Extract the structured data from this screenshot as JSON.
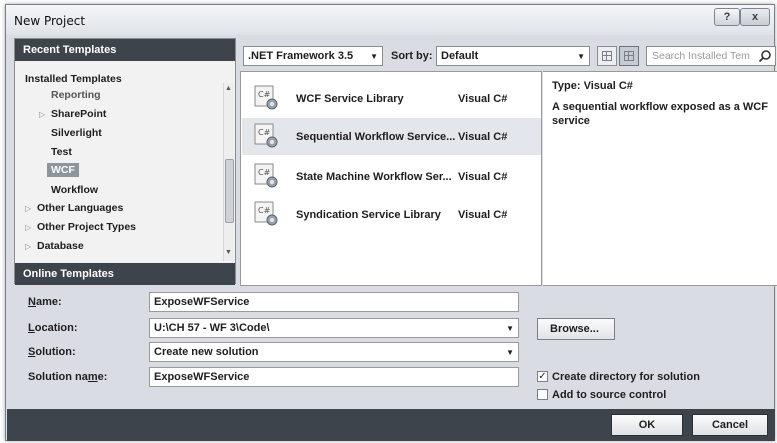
{
  "window": {
    "title": "New Project",
    "help_glyph": "?",
    "close_glyph": "x"
  },
  "left_panel": {
    "recent_header": "Recent Templates",
    "installed_label": "Installed Templates",
    "tree": [
      {
        "label": "Reporting"
      },
      {
        "label": "SharePoint"
      },
      {
        "label": "Silverlight"
      },
      {
        "label": "Test"
      },
      {
        "label": "WCF"
      },
      {
        "label": "Workflow"
      },
      {
        "label": "Other Languages"
      },
      {
        "label": "Other Project Types"
      },
      {
        "label": "Database"
      }
    ],
    "online_header": "Online Templates"
  },
  "toolbar": {
    "framework": ".NET Framework 3.5",
    "sort_label": "Sort by:",
    "sort_value": "Default",
    "search_placeholder": "Search Installed Tem"
  },
  "templates": [
    {
      "name": "WCF Service Library",
      "lang": "Visual C#"
    },
    {
      "name": "Sequential Workflow Service...",
      "lang": "Visual C#"
    },
    {
      "name": "State Machine Workflow Ser...",
      "lang": "Visual C#"
    },
    {
      "name": "Syndication Service Library",
      "lang": "Visual C#"
    }
  ],
  "description": {
    "type_label": "Type:",
    "type_value": "Visual C#",
    "text": "A sequential workflow exposed as a WCF service"
  },
  "form": {
    "name": {
      "label_u": "N",
      "label_rest": "ame:",
      "value": "ExposeWFService"
    },
    "location": {
      "label_u": "L",
      "label_rest": "ocation:",
      "value": "U:\\CH 57 - WF 3\\Code\\"
    },
    "solution": {
      "label_u": "S",
      "label_rest": "olution:",
      "value": "Create new solution"
    },
    "solution_name": {
      "label_pre": "Solution na",
      "label_u": "m",
      "label_rest": "e:",
      "value": "ExposeWFService"
    },
    "browse_label": "Browse...",
    "create_dir_label": "Create directory for solution",
    "create_dir_checked": "✓",
    "source_control_label": "Add to source control"
  },
  "footer": {
    "ok_label": "OK",
    "cancel_label": "Cancel"
  }
}
